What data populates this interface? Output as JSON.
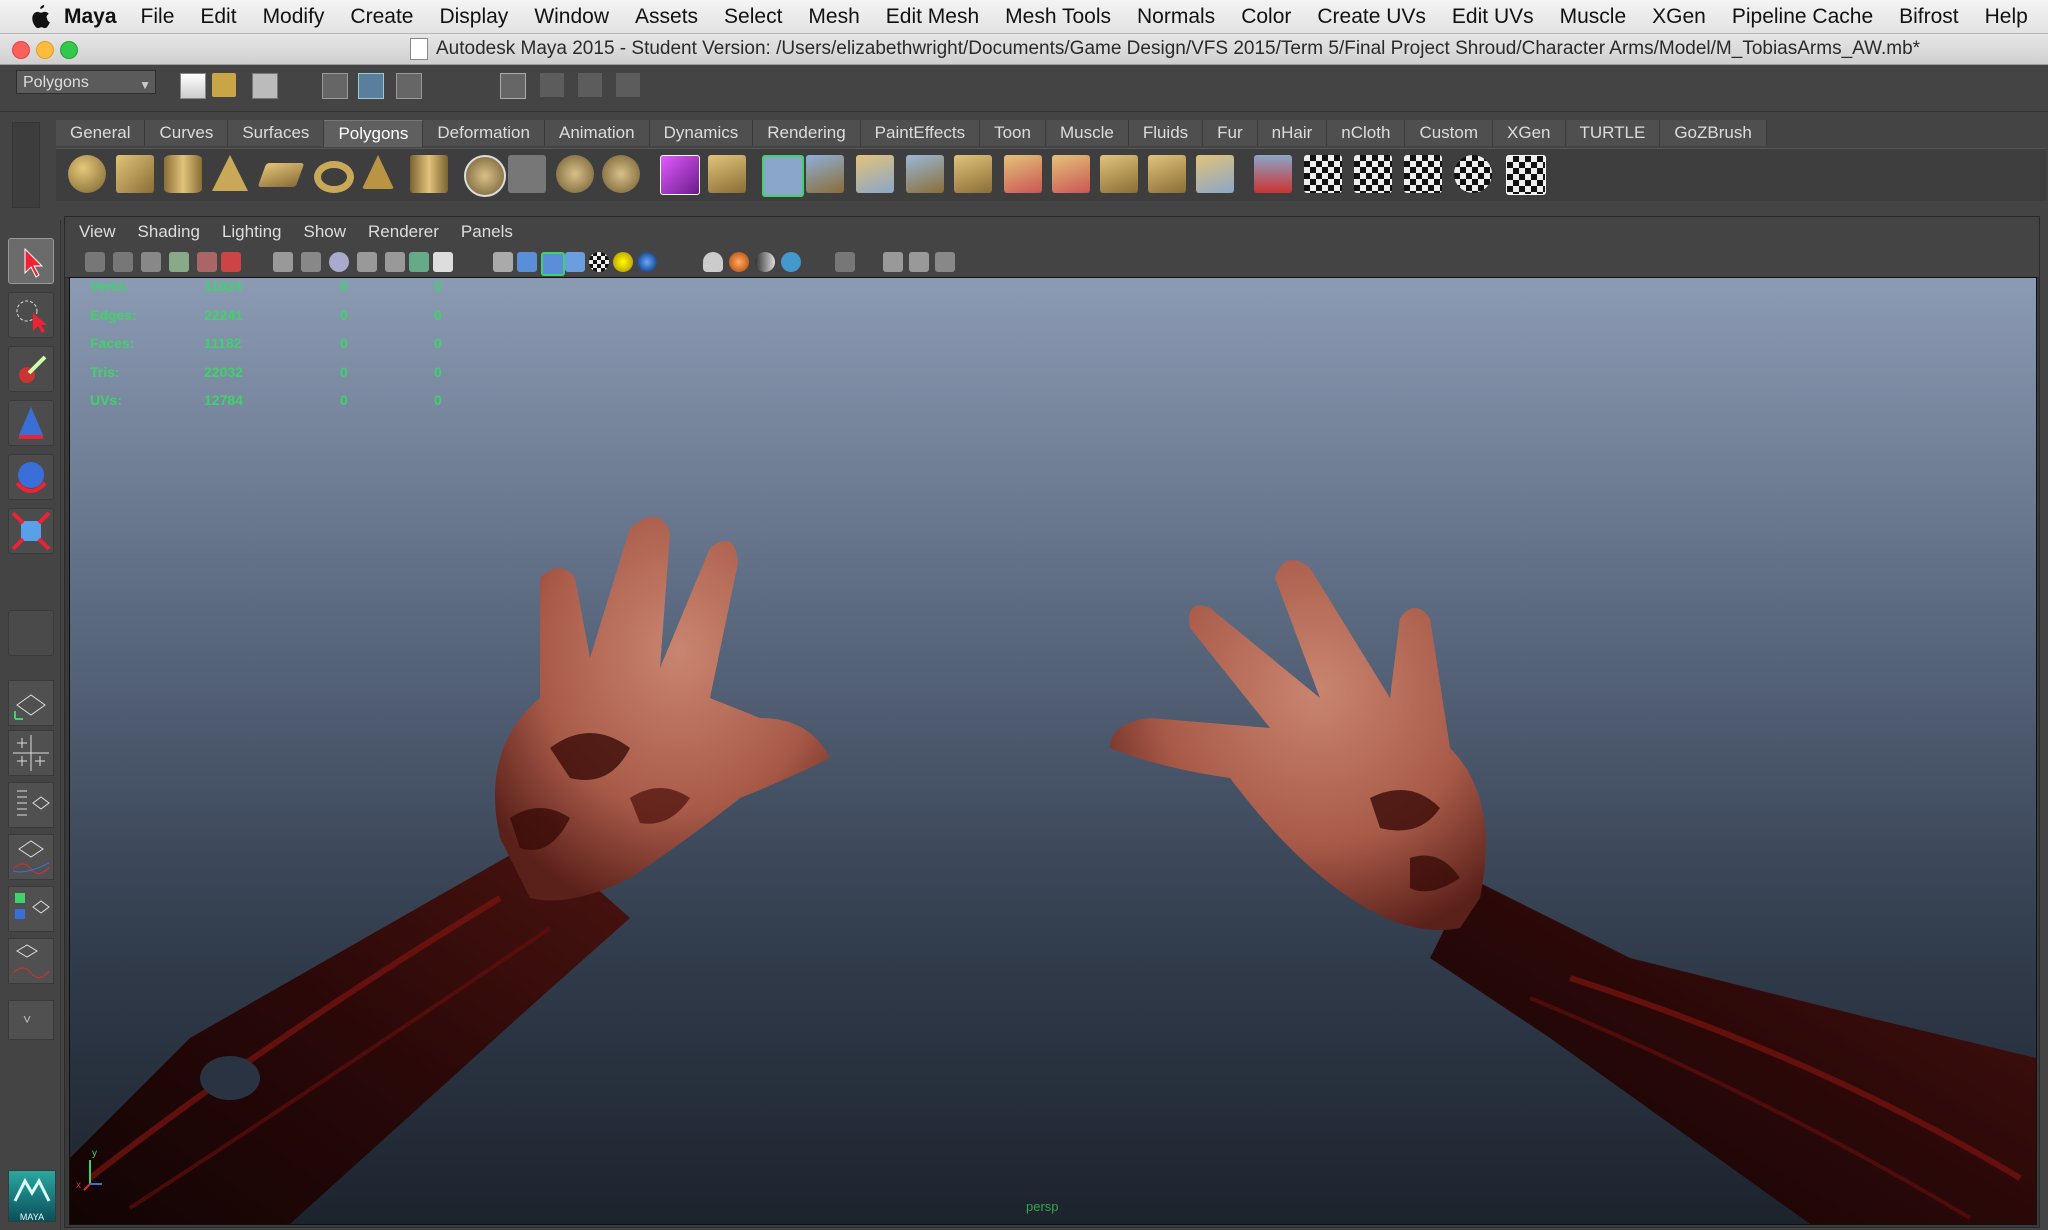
{
  "menubar": {
    "app_name": "Maya",
    "items": [
      "File",
      "Edit",
      "Modify",
      "Create",
      "Display",
      "Window",
      "Assets",
      "Select",
      "Mesh",
      "Edit Mesh",
      "Mesh Tools",
      "Normals",
      "Color",
      "Create UVs",
      "Edit UVs",
      "Muscle",
      "XGen",
      "Pipeline Cache",
      "Bifrost",
      "Help"
    ]
  },
  "window": {
    "title": "Autodesk Maya 2015 - Student Version: /Users/elizabethwright/Documents/Game Design/VFS 2015/Term 5/Final Project Shroud/Character Arms/Model/M_TobiasArms_AW.mb*"
  },
  "status_line": {
    "menu_set": "Polygons"
  },
  "shelf": {
    "tabs": [
      "General",
      "Curves",
      "Surfaces",
      "Polygons",
      "Deformation",
      "Animation",
      "Dynamics",
      "Rendering",
      "PaintEffects",
      "Toon",
      "Muscle",
      "Fluids",
      "Fur",
      "nHair",
      "nCloth",
      "Custom",
      "XGen",
      "TURTLE",
      "GoZBrush"
    ],
    "active_tab": "Polygons"
  },
  "panel": {
    "menus": [
      "View",
      "Shading",
      "Lighting",
      "Show",
      "Renderer",
      "Panels"
    ],
    "camera_label": "persp"
  },
  "heads_up": {
    "rows": [
      {
        "label": "Verts:",
        "c1": "11024",
        "c2": "0",
        "c3": "0"
      },
      {
        "label": "Edges:",
        "c1": "22241",
        "c2": "0",
        "c3": "0"
      },
      {
        "label": "Faces:",
        "c1": "11182",
        "c2": "0",
        "c3": "0"
      },
      {
        "label": "Tris:",
        "c1": "22032",
        "c2": "0",
        "c3": "0"
      },
      {
        "label": "UVs:",
        "c1": "12784",
        "c2": "0",
        "c3": "0"
      }
    ]
  },
  "axis": {
    "x": "x",
    "y": "y"
  },
  "logo": "MAYA",
  "colors": {
    "hud_green": "#3fd26a",
    "viewport_top": "#8b9bb3",
    "viewport_bottom": "#1c232d",
    "skin": "#b86a55"
  }
}
